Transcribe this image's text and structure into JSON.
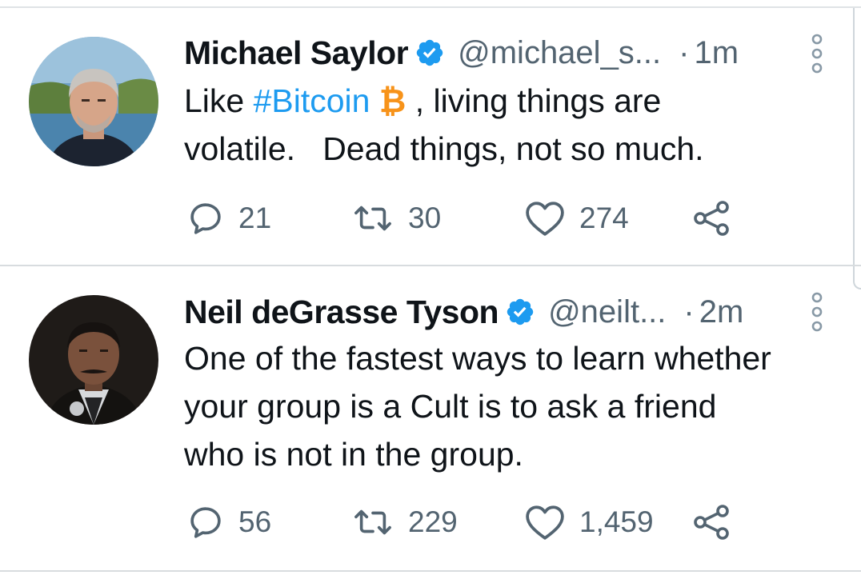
{
  "tweets": [
    {
      "name": "Michael Saylor",
      "handle": "@michael_s...",
      "sep": "·",
      "time": "1m",
      "text": {
        "line1_pre": "Like ",
        "hashtag": "#Bitcoin",
        "btc_emoji": "₿",
        "line1_post": " , living things are",
        "line2": "volatile.   Dead things, not so much."
      },
      "replies": "21",
      "retweets": "30",
      "likes": "274"
    },
    {
      "name": "Neil deGrasse Tyson",
      "handle": "@neilt...",
      "sep": "·",
      "time": "2m",
      "text": {
        "line1": "One of the fastest ways to learn whether",
        "line2": "your group is a Cult is to ask a friend",
        "line3": "who is not in the group."
      },
      "replies": "56",
      "retweets": "229",
      "likes": "1,459"
    }
  ],
  "icons": {
    "verified": "verified-badge-icon",
    "more": "more-vertical-icon",
    "reply": "reply-icon",
    "retweet": "retweet-icon",
    "like": "like-icon",
    "share": "share-icon"
  },
  "colors": {
    "accent": "#1d9bf0",
    "bitcoin": "#f7931a",
    "text_primary": "#0f1419",
    "text_secondary": "#536471",
    "divider": "#d8dcdf"
  }
}
